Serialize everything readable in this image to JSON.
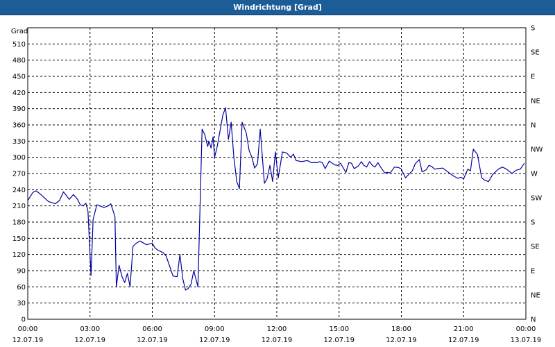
{
  "window": {
    "title": "Windrichtung [Grad]"
  },
  "chart_data": {
    "type": "line",
    "title": "Windrichtung [Grad]",
    "ylabel": "Grad",
    "xlabel": "",
    "ylim": [
      0,
      540
    ],
    "xlim": [
      0,
      24
    ],
    "y_ticks": [
      0,
      30,
      60,
      90,
      120,
      150,
      180,
      210,
      240,
      270,
      300,
      330,
      360,
      390,
      420,
      450,
      480,
      510
    ],
    "x_ticks": [
      {
        "time": "00:00",
        "date": "12.07.19"
      },
      {
        "time": "03:00",
        "date": "12.07.19"
      },
      {
        "time": "06:00",
        "date": "12.07.19"
      },
      {
        "time": "09:00",
        "date": "12.07.19"
      },
      {
        "time": "12:00",
        "date": "12.07.19"
      },
      {
        "time": "15:00",
        "date": "12.07.19"
      },
      {
        "time": "18:00",
        "date": "12.07.19"
      },
      {
        "time": "21:00",
        "date": "12.07.19"
      },
      {
        "time": "00:00",
        "date": "13.07.19"
      }
    ],
    "right_axis_labels": [
      "N",
      "NE",
      "E",
      "SE",
      "S",
      "SW",
      "W",
      "NW",
      "N",
      "NE",
      "E",
      "SE",
      "S"
    ],
    "grid": true,
    "line_color": "#0000a0",
    "series": [
      {
        "x": [
          0.0,
          0.25,
          0.4,
          0.6,
          1.0,
          1.33,
          1.53,
          1.72,
          2.0,
          2.2,
          2.4,
          2.53,
          2.67,
          2.8,
          2.9,
          3.05,
          3.15,
          3.33,
          3.67,
          3.87,
          4.0,
          4.2,
          4.27,
          4.4,
          4.55,
          4.67,
          4.8,
          4.93,
          5.07,
          5.2,
          5.4,
          5.73,
          6.0,
          6.13,
          6.27,
          6.53,
          6.67,
          7.0,
          7.2,
          7.33,
          7.47,
          7.6,
          7.73,
          7.87,
          8.0,
          8.2,
          8.4,
          8.53,
          8.67,
          8.73,
          8.83,
          8.93,
          9.0,
          9.13,
          9.27,
          9.4,
          9.53,
          9.67,
          9.8,
          9.93,
          10.07,
          10.2,
          10.33,
          10.53,
          10.67,
          10.8,
          10.93,
          11.07,
          11.2,
          11.4,
          11.53,
          11.67,
          11.8,
          11.93,
          12.07,
          12.27,
          12.47,
          12.67,
          12.8,
          12.93,
          13.2,
          13.47,
          13.67,
          13.93,
          14.07,
          14.2,
          14.33,
          14.53,
          14.67,
          14.8,
          14.93,
          15.07,
          15.33,
          15.47,
          15.6,
          15.73,
          15.93,
          16.07,
          16.2,
          16.33,
          16.47,
          16.6,
          16.73,
          16.87,
          17.0,
          17.2,
          17.33,
          17.47,
          17.67,
          17.87,
          18.0,
          18.2,
          18.4,
          18.53,
          18.67,
          18.87,
          19.0,
          19.2,
          19.33,
          19.47,
          19.6,
          19.73,
          20.0,
          20.27,
          20.53,
          20.73,
          20.87,
          21.0,
          21.2,
          21.33,
          21.47,
          21.67,
          21.87,
          22.0,
          22.2,
          22.4,
          22.67,
          22.87,
          23.07,
          23.33,
          23.53,
          23.73,
          23.93
        ],
        "y": [
          220,
          235,
          238,
          232,
          218,
          214,
          220,
          236,
          222,
          231,
          222,
          212,
          210,
          215,
          200,
          81,
          185,
          212,
          207,
          210,
          214,
          190,
          60,
          100,
          78,
          68,
          85,
          60,
          135,
          140,
          145,
          138,
          141,
          132,
          128,
          123,
          117,
          80,
          79,
          120,
          75,
          54,
          57,
          65,
          90,
          60,
          352,
          342,
          320,
          330,
          317,
          338,
          300,
          320,
          350,
          378,
          392,
          333,
          365,
          300,
          255,
          242,
          365,
          345,
          312,
          300,
          280,
          288,
          352,
          252,
          260,
          285,
          255,
          310,
          262,
          310,
          308,
          300,
          306,
          294,
          292,
          294,
          290,
          290,
          292,
          290,
          279,
          293,
          289,
          286,
          285,
          289,
          272,
          290,
          289,
          279,
          284,
          292,
          285,
          282,
          292,
          285,
          282,
          290,
          282,
          271,
          272,
          271,
          282,
          281,
          278,
          262,
          270,
          275,
          288,
          296,
          273,
          277,
          285,
          283,
          278,
          279,
          280,
          272,
          265,
          261,
          263,
          260,
          278,
          275,
          315,
          305,
          262,
          258,
          255,
          268,
          278,
          282,
          278,
          270,
          276,
          278,
          289
        ]
      }
    ]
  }
}
